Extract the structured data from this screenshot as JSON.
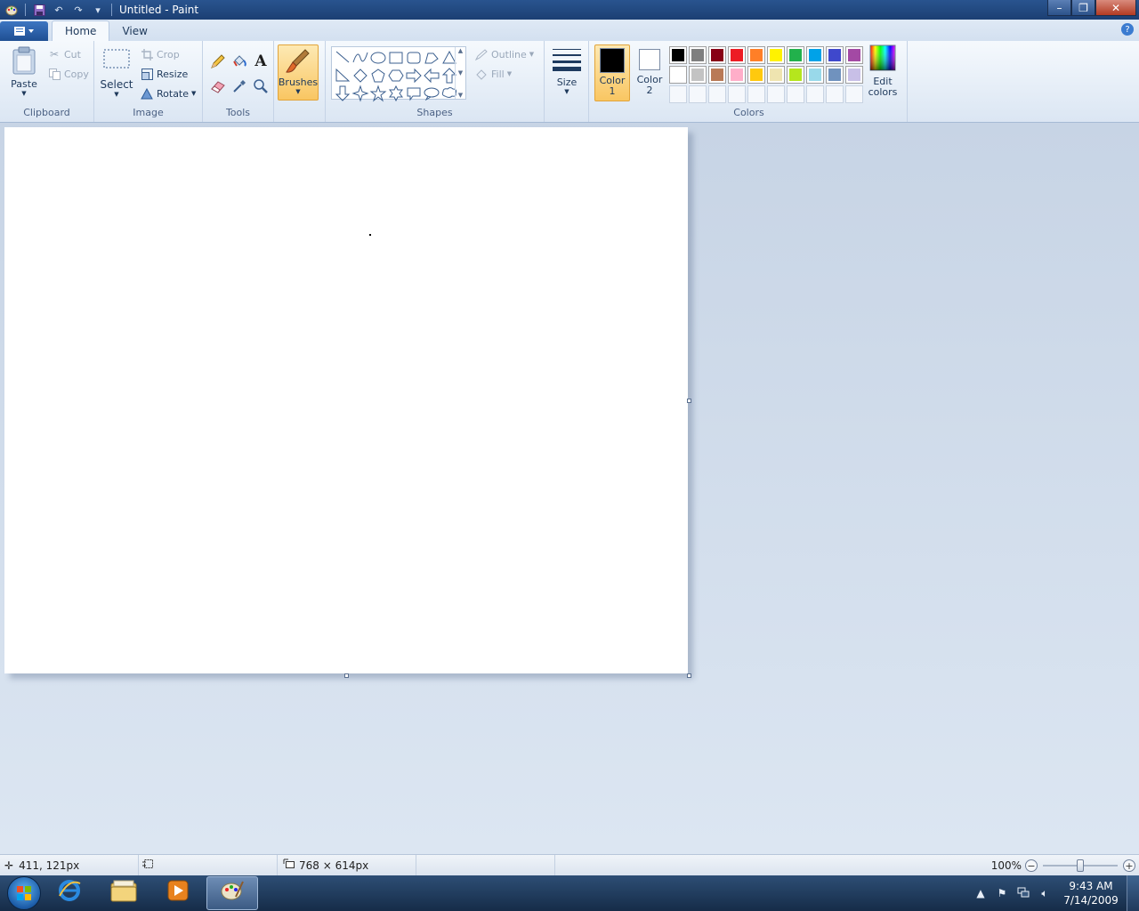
{
  "window": {
    "title": "Untitled - Paint",
    "controls": {
      "minimize": "–",
      "restore": "❐",
      "close": "✕"
    }
  },
  "ribbon_tabs": [
    {
      "label": "Home",
      "active": true
    },
    {
      "label": "View",
      "active": false
    }
  ],
  "help_label": "?",
  "clipboard": {
    "group_label": "Clipboard",
    "paste": "Paste",
    "cut": "Cut",
    "copy": "Copy"
  },
  "image": {
    "group_label": "Image",
    "select": "Select",
    "crop": "Crop",
    "resize": "Resize",
    "rotate": "Rotate"
  },
  "tools": {
    "group_label": "Tools"
  },
  "brushes": {
    "label": "Brushes"
  },
  "shapes": {
    "group_label": "Shapes",
    "outline": "Outline",
    "fill": "Fill",
    "items": [
      "line",
      "curve",
      "oval",
      "rectangle",
      "rounded-rectangle",
      "polygon",
      "triangle",
      "right-triangle",
      "diamond",
      "pentagon",
      "hexagon",
      "right-arrow",
      "left-arrow",
      "up-arrow",
      "down-arrow",
      "four-point-star",
      "five-point-star",
      "six-point-star",
      "rounded-callout",
      "oval-callout",
      "cloud-callout"
    ]
  },
  "size": {
    "label": "Size"
  },
  "colors": {
    "group_label": "Colors",
    "color1_label": [
      "Color",
      "1"
    ],
    "color2_label": [
      "Color",
      "2"
    ],
    "color1": "#000000",
    "color2": "#ffffff",
    "edit_colors": [
      "Edit",
      "colors"
    ],
    "palette": [
      "#000000",
      "#7f7f7f",
      "#880015",
      "#ed1c24",
      "#ff7f27",
      "#fff200",
      "#22b14c",
      "#00a2e8",
      "#3f48cc",
      "#a349a4",
      "#ffffff",
      "#c3c3c3",
      "#b97a57",
      "#ffaec9",
      "#ffc90e",
      "#efe4b0",
      "#b5e61d",
      "#99d9ea",
      "#7092be",
      "#c8bfe7",
      "",
      "",
      "",
      "",
      "",
      "",
      "",
      "",
      "",
      ""
    ]
  },
  "status": {
    "cursor_pos": "411, 121px",
    "image_size": "768 × 614px",
    "zoom": "100%",
    "zoom_fraction": 0.5
  },
  "taskbar": {
    "time": "9:43 AM",
    "date": "7/14/2009"
  }
}
